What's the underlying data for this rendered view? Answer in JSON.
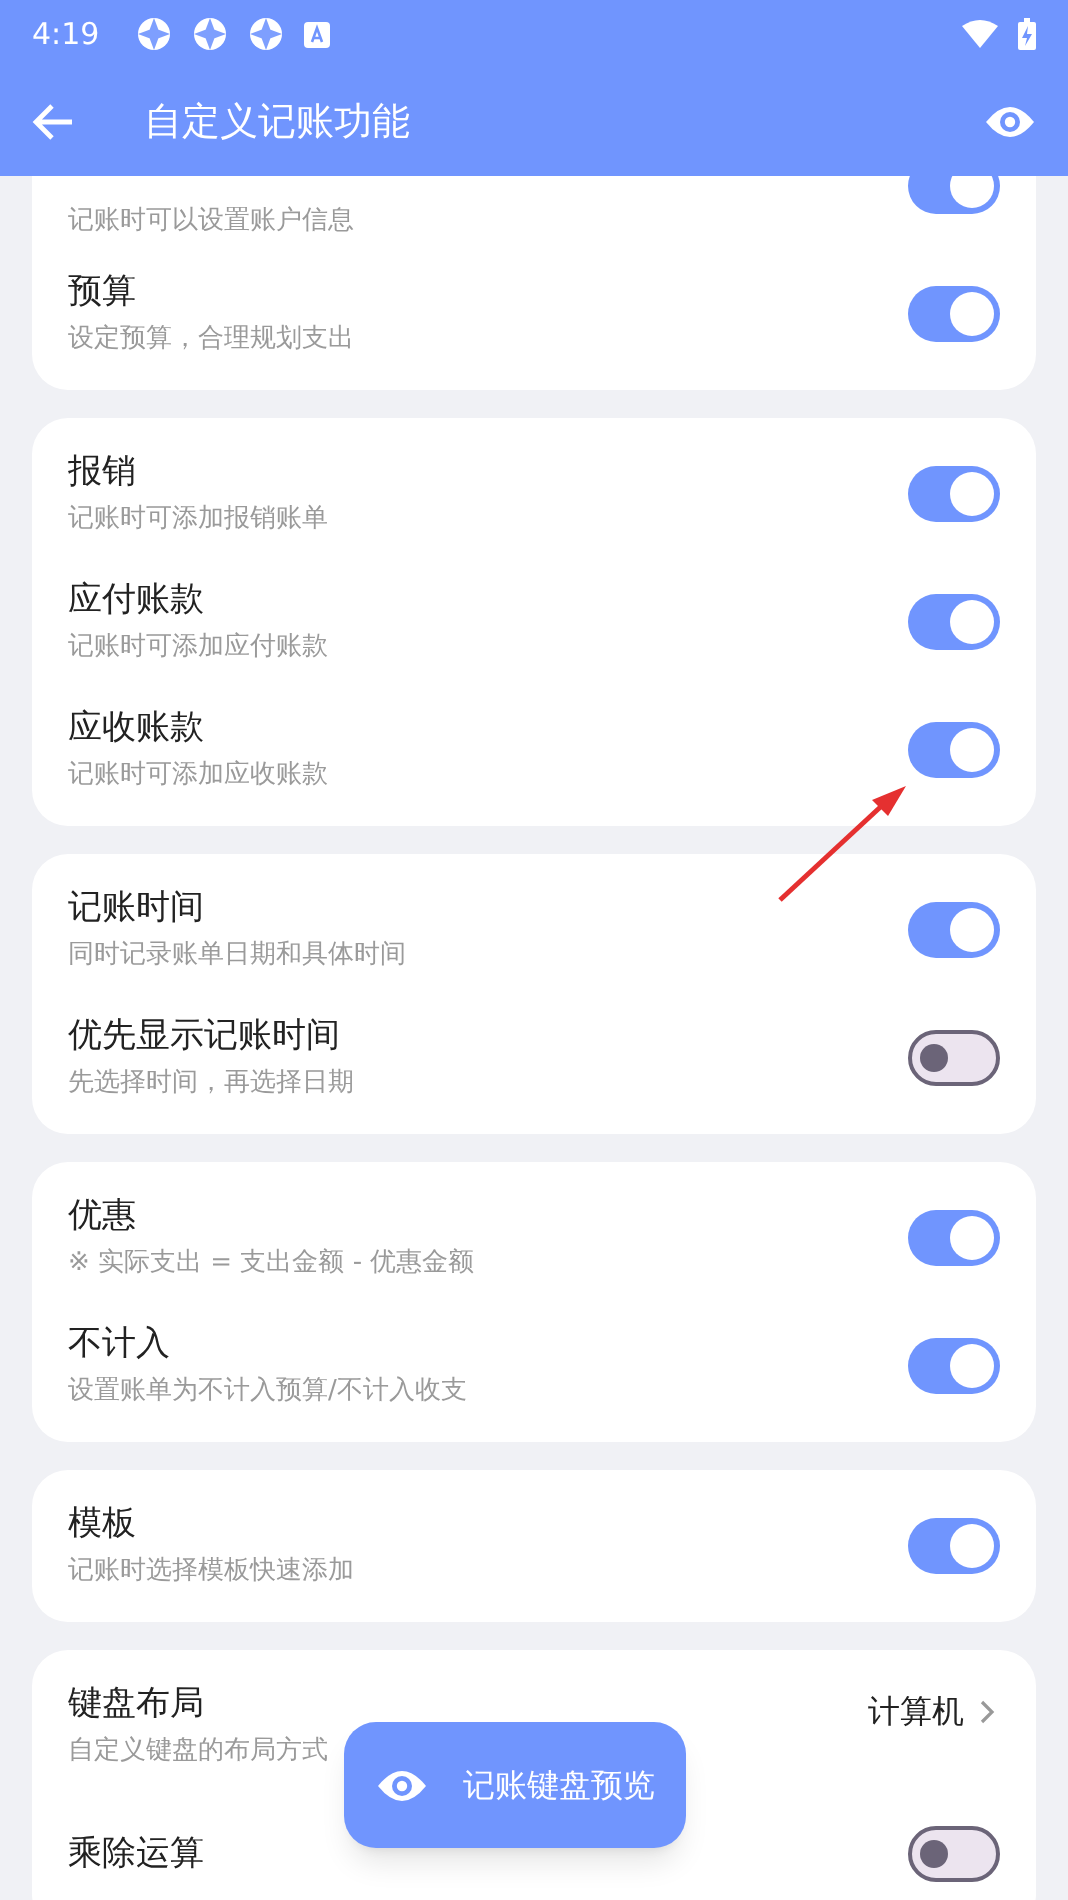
{
  "status_bar": {
    "time": "4:19"
  },
  "app_bar": {
    "title": "自定义记账功能"
  },
  "groups": [
    {
      "items": [
        {
          "kind": "toggle",
          "subtitle": "记账时可以设置账户信息",
          "on": true
        },
        {
          "kind": "toggle",
          "title": "预算",
          "subtitle": "设定预算，合理规划支出",
          "on": true
        }
      ]
    },
    {
      "items": [
        {
          "kind": "toggle",
          "title": "报销",
          "subtitle": "记账时可添加报销账单",
          "on": true
        },
        {
          "kind": "toggle",
          "title": "应付账款",
          "subtitle": "记账时可添加应付账款",
          "on": true
        },
        {
          "kind": "toggle",
          "title": "应收账款",
          "subtitle": "记账时可添加应收账款",
          "on": true
        }
      ]
    },
    {
      "items": [
        {
          "kind": "toggle",
          "title": "记账时间",
          "subtitle": "同时记录账单日期和具体时间",
          "on": true
        },
        {
          "kind": "toggle",
          "title": "优先显示记账时间",
          "subtitle": "先选择时间，再选择日期",
          "on": false
        }
      ]
    },
    {
      "items": [
        {
          "kind": "toggle",
          "title": "优惠",
          "subtitle": "※ 实际支出 = 支出金额 - 优惠金额",
          "on": true
        },
        {
          "kind": "toggle",
          "title": "不计入",
          "subtitle": "设置账单为不计入预算/不计入收支",
          "on": true
        }
      ]
    },
    {
      "items": [
        {
          "kind": "toggle",
          "title": "模板",
          "subtitle": "记账时选择模板快速添加",
          "on": true
        }
      ]
    },
    {
      "items": [
        {
          "kind": "choice",
          "title": "键盘布局",
          "subtitle": "自定义键盘的布局方式",
          "value": "计算机"
        },
        {
          "kind": "toggle",
          "title": "乘除运算",
          "on": false
        }
      ]
    }
  ],
  "fab": {
    "label": "记账键盘预览"
  }
}
